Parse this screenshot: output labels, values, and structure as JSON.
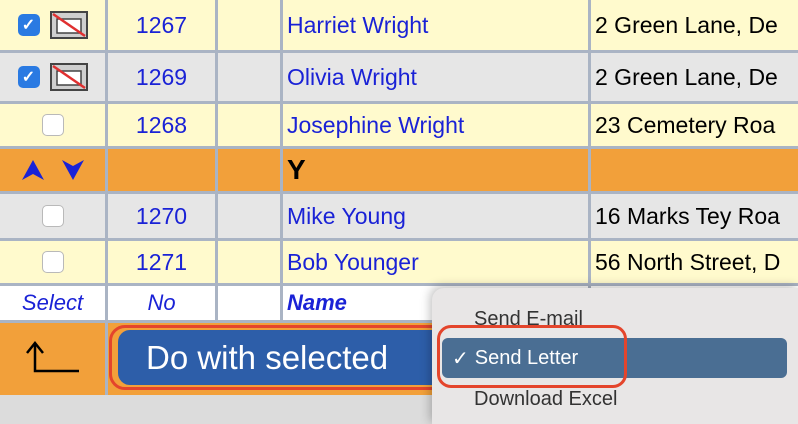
{
  "rows": [
    {
      "checked": true,
      "no": "1267",
      "name": "Harriet Wright",
      "address": "2 Green Lane, De"
    },
    {
      "checked": true,
      "no": "1269",
      "name": "Olivia Wright",
      "address": "2 Green Lane, De"
    },
    {
      "checked": false,
      "no": "1268",
      "name": "Josephine Wright",
      "address": "23 Cemetery Roa"
    },
    {
      "letter": "Y"
    },
    {
      "checked": false,
      "no": "1270",
      "name": "Mike Young",
      "address": "16 Marks Tey Roa"
    },
    {
      "checked": false,
      "no": "1271",
      "name": "Bob Younger",
      "address": "56 North Street, D"
    }
  ],
  "header": {
    "select": "Select",
    "no": "No",
    "name": "Name"
  },
  "action": {
    "label": "Do with selected"
  },
  "menu": {
    "items": [
      "Send E-mail",
      "Send Letter",
      "Download Excel"
    ],
    "selected": "Send Letter",
    "check": "✓"
  },
  "colors": {
    "link": "#1a22d6",
    "orange": "#f2a03a",
    "highlight": "#e4452c",
    "menu_selected": "#4a6e93"
  },
  "icons": {
    "mail_off": "mail-crossed-icon",
    "up": "up-arrow-icon",
    "down": "down-arrow-icon",
    "return": "return-arrow-icon"
  }
}
